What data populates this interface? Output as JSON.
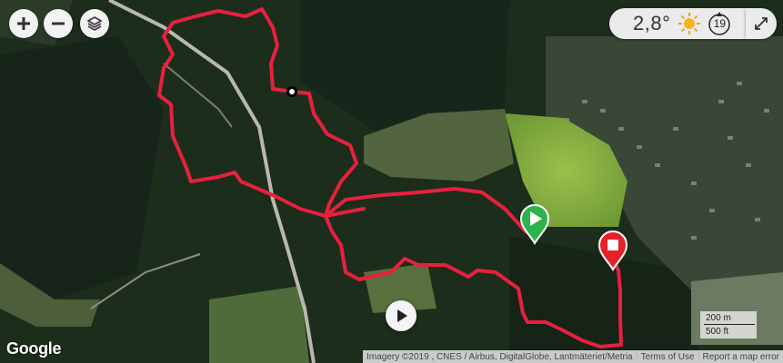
{
  "controls": {
    "zoom_in": "zoom-in-icon",
    "zoom_out": "zoom-out-icon",
    "layers": "layers-icon"
  },
  "weather": {
    "temperature": "2,8°",
    "condition_icon": "sun-icon",
    "wind_speed": "19",
    "wind_icon": "wind-direction-icon"
  },
  "expand_icon": "expand-arrows-icon",
  "play_icon": "play-icon",
  "markers": {
    "start": {
      "icon": "start-play-marker-icon",
      "color": "#2db34a"
    },
    "end": {
      "icon": "end-stop-marker-icon",
      "color": "#e8202a"
    },
    "current": {
      "icon": "position-dot-icon"
    }
  },
  "route": {
    "color": "#e8203f"
  },
  "branding": {
    "logo": "Google"
  },
  "attribution": {
    "imagery": "Imagery ©2019 , CNES / Airbus, DigitalGlobe, Lantmäteriet/Metria",
    "terms": "Terms of Use",
    "report": "Report a map error"
  },
  "scale": {
    "metric": "200 m",
    "imperial": "500 ft"
  }
}
